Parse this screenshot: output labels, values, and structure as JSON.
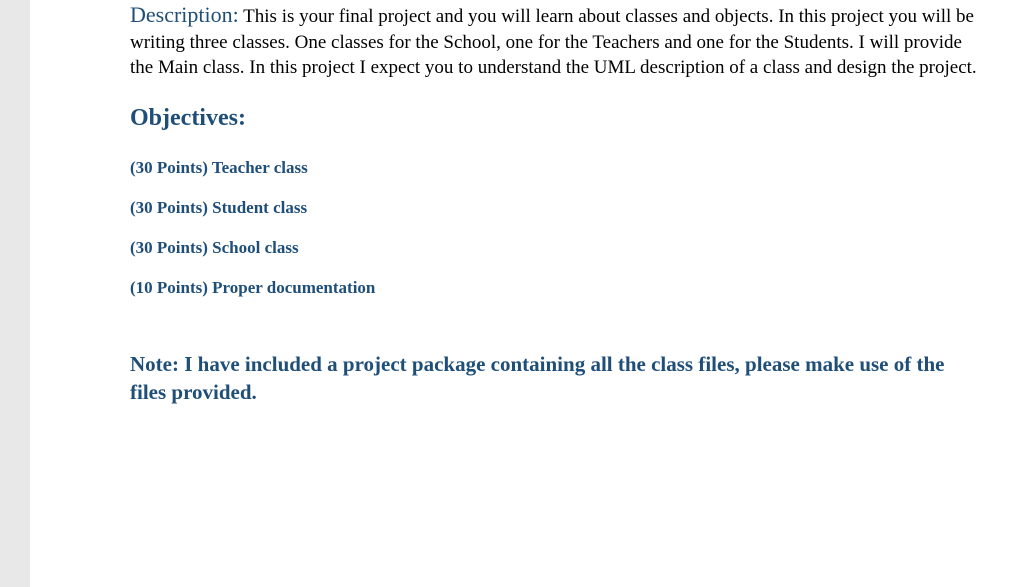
{
  "description": {
    "label": "Description:",
    "text": " This is your final project and you will learn about classes and objects. In this project you will be writing three classes. One classes for the School, one for the Teachers and one for the Students. I will provide the Main class. In this project I expect you to understand the UML description of a class and design the project."
  },
  "objectives": {
    "heading": "Objectives:",
    "items": [
      "(30 Points) Teacher class",
      "(30 Points) Student class",
      "(30 Points) School class",
      "(10 Points) Proper documentation"
    ]
  },
  "note": "Note: I have included a project package containing all the class files, please make use of the files provided."
}
